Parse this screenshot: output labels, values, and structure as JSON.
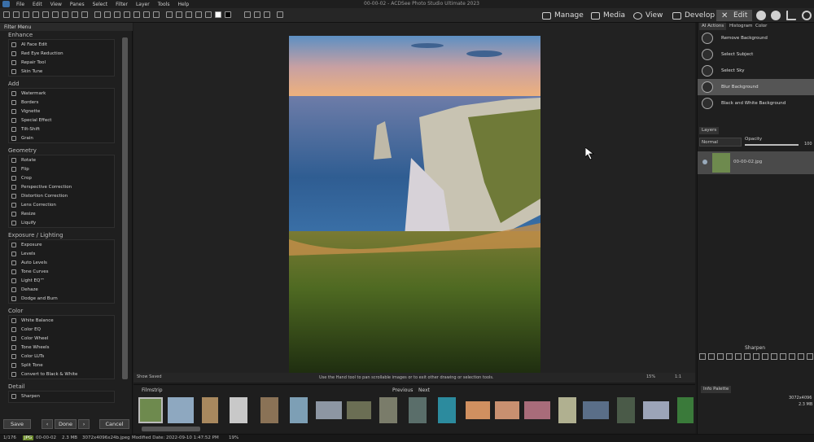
{
  "app": {
    "title": "00-00-02 - ACDSee Photo Studio Ultimate 2023"
  },
  "menu": [
    "File",
    "Edit",
    "View",
    "Panes",
    "Select",
    "Filter",
    "Layer",
    "Tools",
    "Help"
  ],
  "modes": {
    "manage": "Manage",
    "media": "Media",
    "view": "View",
    "develop": "Develop",
    "edit": "Edit"
  },
  "filter_menu": {
    "title": "Filter Menu",
    "groups": [
      {
        "name": "Enhance",
        "items": [
          "AI Face Edit",
          "Red Eye Reduction",
          "Repair Tool",
          "Skin Tune"
        ]
      },
      {
        "name": "Add",
        "items": [
          "Watermark",
          "Borders",
          "Vignette",
          "Special Effect",
          "Tilt-Shift",
          "Grain"
        ]
      },
      {
        "name": "Geometry",
        "items": [
          "Rotate",
          "Flip",
          "Crop",
          "Perspective Correction",
          "Distortion Correction",
          "Lens Correction",
          "Resize",
          "Liquify"
        ]
      },
      {
        "name": "Exposure / Lighting",
        "items": [
          "Exposure",
          "Levels",
          "Auto Levels",
          "Tone Curves",
          "Light EQ™",
          "Dehaze",
          "Dodge and Burn"
        ]
      },
      {
        "name": "Color",
        "items": [
          "White Balance",
          "Color EQ",
          "Color Wheel",
          "Tone Wheels",
          "Color LUTs",
          "Split Tone",
          "Convert to Black & White"
        ]
      },
      {
        "name": "Detail",
        "items": [
          "Sharpen"
        ]
      }
    ],
    "buttons": {
      "save": "Save",
      "done": "Done",
      "cancel": "Cancel"
    }
  },
  "hint": {
    "show_saved": "Show Saved",
    "text": "Use the Hand tool to pan scrollable images or to exit other drawing or selection tools.",
    "zoom": "15%",
    "ratio": "1:1"
  },
  "filmstrip": {
    "title": "Filmstrip",
    "previous": "Previous",
    "next": "Next"
  },
  "ai_actions": {
    "tabs": [
      "AI Actions",
      "Histogram",
      "Color"
    ],
    "items": [
      "Remove Background",
      "Select Subject",
      "Select Sky",
      "Blur Background",
      "Black and White Background"
    ],
    "selected_index": 3
  },
  "layers": {
    "title": "Layers",
    "blend": "Normal",
    "opacity_label": "Opacity",
    "opacity_value": "100",
    "layer_name": "00-00-02.jpg"
  },
  "sharpen_panel": {
    "title": "Sharpen"
  },
  "info_palette": {
    "title": "Info Palette",
    "size": "3072x4096",
    "filesize": "2.3 MB"
  },
  "status": {
    "count": "1/176",
    "format": "JPG",
    "name": "00-00-02",
    "size": "2.3 MB",
    "dims": "3072x4096x24b.jpeg",
    "modified": "Modified Date: 2022-09-10 1:47:52 PM",
    "zoom": "19%"
  },
  "colors": {
    "accent": "#4a4a4a",
    "selected": "#555555"
  }
}
